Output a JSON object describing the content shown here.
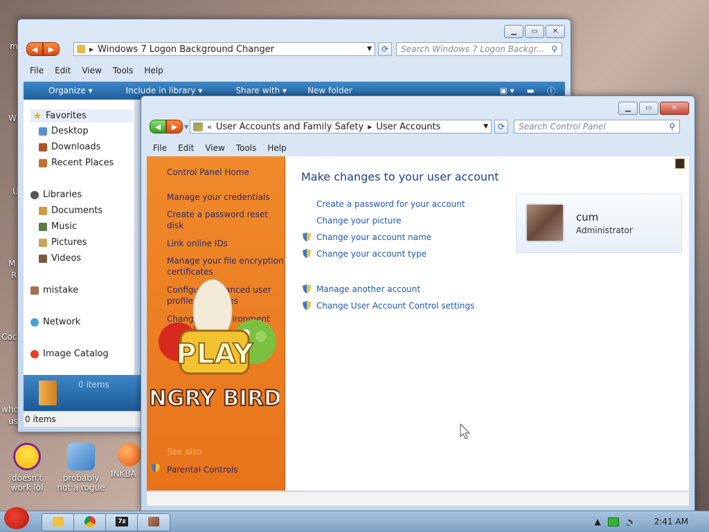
{
  "desktop": {
    "icons": [
      {
        "label": "doesn't work lol"
      },
      {
        "label": "probably not a rogue"
      },
      {
        "label": "INKBA"
      }
    ],
    "fragments": {
      "f1": "m",
      "f2": "W",
      "f3": "U",
      "f4": "M",
      "f5": "R",
      "f6": "Coc",
      "f7": "who",
      "f8": "us"
    }
  },
  "explorer": {
    "address": "Windows 7 Logon Background Changer",
    "search_placeholder": "Search Windows 7 Logon Backgr...",
    "menu": [
      "File",
      "Edit",
      "View",
      "Tools",
      "Help"
    ],
    "toolbar": [
      "Organize",
      "Include in library",
      "Share with",
      "New folder"
    ],
    "nav": {
      "favorites": "Favorites",
      "desktop": "Desktop",
      "downloads": "Downloads",
      "recent": "Recent Places",
      "libraries": "Libraries",
      "documents": "Documents",
      "music": "Music",
      "pictures": "Pictures",
      "videos": "Videos",
      "mistake": "mistake",
      "network": "Network",
      "image_catalog": "Image Catalog"
    },
    "details_count": "0 items",
    "status": "0 items"
  },
  "controlpanel": {
    "breadcrumb": [
      "User Accounts and Family Safety",
      "User Accounts"
    ],
    "search_placeholder": "Search Control Panel",
    "menu": [
      "File",
      "Edit",
      "View",
      "Tools",
      "Help"
    ],
    "left": {
      "home": "Control Panel Home",
      "links": [
        "Manage your credentials",
        "Create a password reset disk",
        "Link online IDs",
        "Manage your file encryption certificates",
        "Configure advanced user profile properties",
        "Change my environment variables"
      ],
      "see_also": "See also",
      "parental": "Parental Controls"
    },
    "title": "Make changes to your user account",
    "tasks": [
      "Create a password for your account",
      "Change your picture",
      "Change your account name",
      "Change your account type",
      "Manage another account",
      "Change User Account Control settings"
    ],
    "account": {
      "name": "cum",
      "role": "Administrator"
    }
  },
  "overlay": {
    "play": "PLAY",
    "title": "ANGRY BIRDS"
  },
  "taskbar": {
    "clock": "2:41 AM"
  }
}
